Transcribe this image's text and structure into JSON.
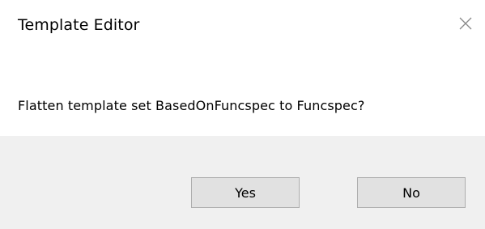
{
  "window": {
    "title": "Template Editor",
    "close_icon": "close-icon"
  },
  "dialog": {
    "message": "Flatten template set BasedOnFuncspec to Funcspec?"
  },
  "buttons": {
    "yes_label": "Yes",
    "no_label": "No"
  }
}
